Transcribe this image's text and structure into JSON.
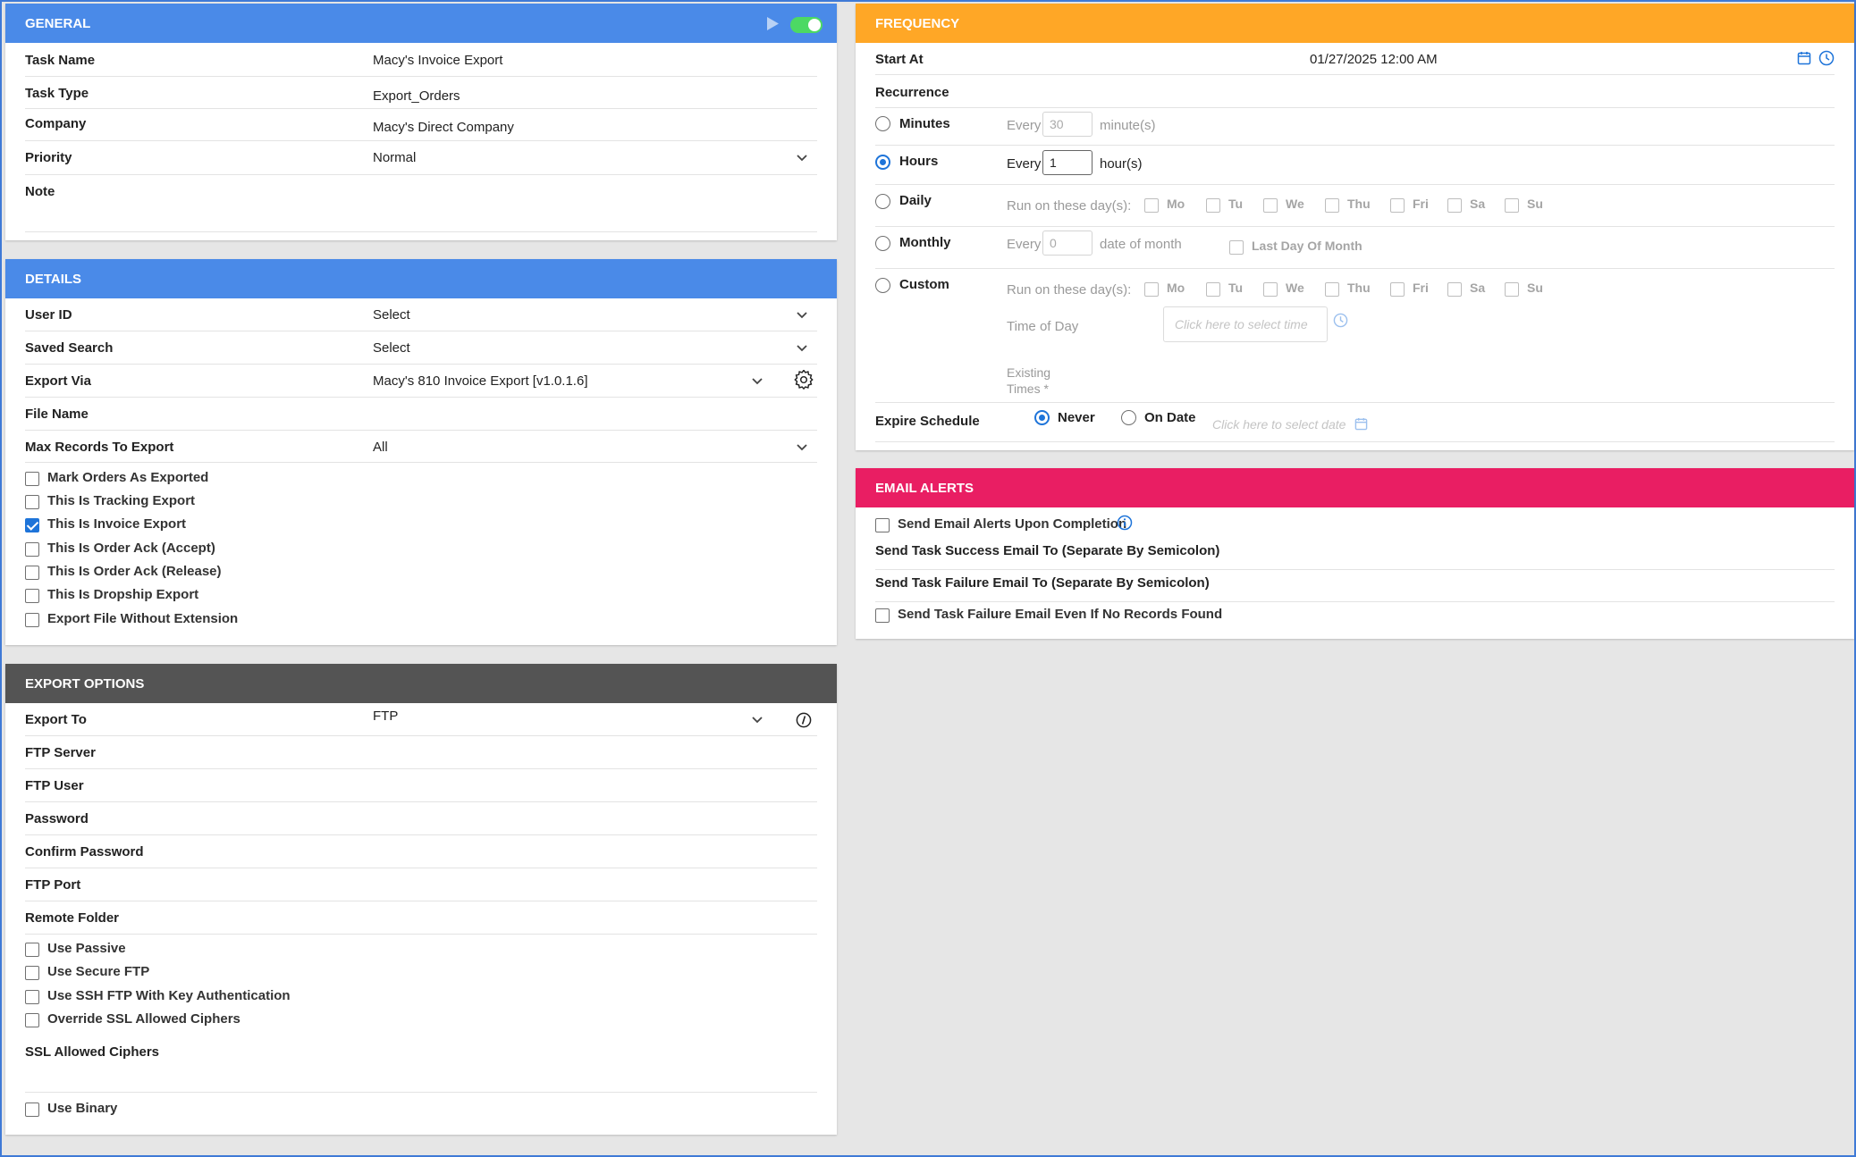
{
  "general": {
    "title": "GENERAL",
    "task_name_label": "Task Name",
    "task_name": "Macy's Invoice Export",
    "task_type_label": "Task Type",
    "task_type": "Export_Orders",
    "company_label": "Company",
    "company": "Macy's Direct Company",
    "priority_label": "Priority",
    "priority": "Normal",
    "note_label": "Note",
    "enabled": true
  },
  "details": {
    "title": "DETAILS",
    "user_id_label": "User ID",
    "user_id": "Select",
    "saved_search_label": "Saved Search",
    "saved_search": "Select",
    "export_via_label": "Export Via",
    "export_via": "Macy's 810 Invoice Export [v1.0.1.6]",
    "file_name_label": "File Name",
    "max_records_label": "Max Records To Export",
    "max_records": "All",
    "checks": [
      {
        "label": "Mark Orders As Exported",
        "checked": false
      },
      {
        "label": "This Is Tracking Export",
        "checked": false
      },
      {
        "label": "This Is Invoice Export",
        "checked": true
      },
      {
        "label": "This Is Order Ack (Accept)",
        "checked": false
      },
      {
        "label": "This Is Order Ack (Release)",
        "checked": false
      },
      {
        "label": "This Is Dropship Export",
        "checked": false
      },
      {
        "label": "Export File Without Extension",
        "checked": false
      }
    ]
  },
  "export_options": {
    "title": "EXPORT OPTIONS",
    "export_to_label": "Export To",
    "export_to": "FTP",
    "fields": [
      "FTP Server",
      "FTP User",
      "Password",
      "Confirm Password",
      "FTP Port",
      "Remote Folder"
    ],
    "checks": [
      {
        "label": "Use Passive",
        "checked": false
      },
      {
        "label": "Use Secure FTP",
        "checked": false
      },
      {
        "label": "Use SSH FTP With Key Authentication",
        "checked": false
      },
      {
        "label": "Override SSL Allowed Ciphers",
        "checked": false
      }
    ],
    "ciphers_label": "SSL Allowed Ciphers",
    "binary_label": "Use Binary"
  },
  "frequency": {
    "title": "FREQUENCY",
    "start_label": "Start At",
    "start_value": "01/27/2025 12:00 AM",
    "recurrence_label": "Recurrence",
    "minutes_label": "Minutes",
    "every": "Every",
    "minutes_value": "30",
    "minutes_unit": "minute(s)",
    "hours_label": "Hours",
    "hours_value": "1",
    "hours_unit": "hour(s)",
    "daily_label": "Daily",
    "run_days_label": "Run on these day(s):",
    "days": [
      "Mo",
      "Tu",
      "We",
      "Thu",
      "Fri",
      "Sa",
      "Su"
    ],
    "monthly_label": "Monthly",
    "monthly_value": "0",
    "monthly_unit": "date of month",
    "last_day_label": "Last Day Of Month",
    "custom_label": "Custom",
    "time_of_day_label": "Time of Day",
    "time_placeholder": "Click here to select time",
    "existing_times_1": "Existing",
    "existing_times_2": "Times *",
    "expire_label": "Expire Schedule",
    "never_label": "Never",
    "on_date_label": "On Date",
    "date_placeholder": "Click here to select date"
  },
  "email": {
    "title": "EMAIL ALERTS",
    "send_alerts_label": "Send Email Alerts Upon Completion",
    "success_label": "Send Task Success Email To (Separate By Semicolon)",
    "failure_label": "Send Task Failure Email To (Separate By Semicolon)",
    "failure_no_records_label": "Send Task Failure Email Even If No Records Found"
  },
  "colors": {
    "general": "#4a8ae8",
    "details": "#4a8ae8",
    "export": "#545454",
    "frequency": "#ffa726",
    "email": "#e91e63",
    "accent": "#1e74d9"
  }
}
